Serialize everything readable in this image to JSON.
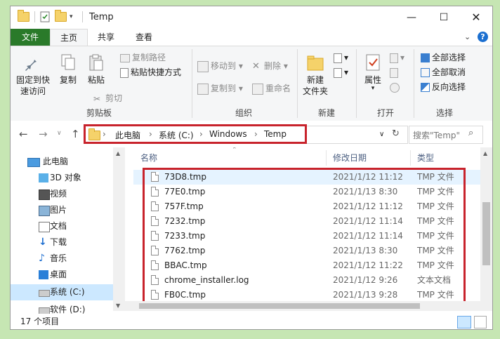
{
  "window": {
    "title": "Temp"
  },
  "ribbon_tabs": {
    "file": "文件",
    "home": "主页",
    "share": "共享",
    "view": "查看"
  },
  "clipboard": {
    "pin": "固定到快\n速访问",
    "copy": "复制",
    "paste": "粘贴",
    "copy_path": "复制路径",
    "paste_shortcut": "粘贴快捷方式",
    "cut": "剪切",
    "group": "剪贴板"
  },
  "organize": {
    "move_to": "移动到",
    "delete": "删除",
    "copy_to": "复制到",
    "rename": "重命名",
    "group": "组织"
  },
  "new": {
    "new_folder": "新建\n文件夹",
    "group": "新建"
  },
  "open": {
    "properties": "属性",
    "group": "打开"
  },
  "select": {
    "select_all": "全部选择",
    "select_none": "全部取消",
    "invert": "反向选择",
    "group": "选择"
  },
  "address": {
    "crumbs": [
      "此电脑",
      "系统 (C:)",
      "Windows",
      "Temp"
    ],
    "search_placeholder": "搜索\"Temp\""
  },
  "nav_pane": {
    "items": [
      {
        "label": "此电脑",
        "icon": "pc-icon"
      },
      {
        "label": "3D 对象",
        "icon": "3d-objects-icon"
      },
      {
        "label": "视频",
        "icon": "video-icon"
      },
      {
        "label": "图片",
        "icon": "pictures-icon"
      },
      {
        "label": "文档",
        "icon": "documents-icon"
      },
      {
        "label": "下载",
        "icon": "download-icon"
      },
      {
        "label": "音乐",
        "icon": "music-icon"
      },
      {
        "label": "桌面",
        "icon": "desktop-icon"
      },
      {
        "label": "系统 (C:)",
        "icon": "drive-icon",
        "selected": true
      },
      {
        "label": "软件 (D:)",
        "icon": "drive-icon"
      }
    ]
  },
  "columns": {
    "name": "名称",
    "date": "修改日期",
    "type": "类型"
  },
  "files": [
    {
      "name": "73D8.tmp",
      "date": "2021/1/12 11:12",
      "type": "TMP 文件"
    },
    {
      "name": "77E0.tmp",
      "date": "2021/1/13 8:30",
      "type": "TMP 文件"
    },
    {
      "name": "757F.tmp",
      "date": "2021/1/12 11:12",
      "type": "TMP 文件"
    },
    {
      "name": "7232.tmp",
      "date": "2021/1/12 11:14",
      "type": "TMP 文件"
    },
    {
      "name": "7233.tmp",
      "date": "2021/1/12 11:14",
      "type": "TMP 文件"
    },
    {
      "name": "7762.tmp",
      "date": "2021/1/13 8:30",
      "type": "TMP 文件"
    },
    {
      "name": "BBAC.tmp",
      "date": "2021/1/12 11:22",
      "type": "TMP 文件"
    },
    {
      "name": "chrome_installer.log",
      "date": "2021/1/12 9:26",
      "type": "文本文档"
    },
    {
      "name": "FB0C.tmp",
      "date": "2021/1/13 9:28",
      "type": "TMP 文件"
    }
  ],
  "status": {
    "count": "17 个项目"
  },
  "colors": {
    "file_tab": "#2a7a2a",
    "highlight": "#c8232c",
    "selection": "#cce8ff"
  }
}
